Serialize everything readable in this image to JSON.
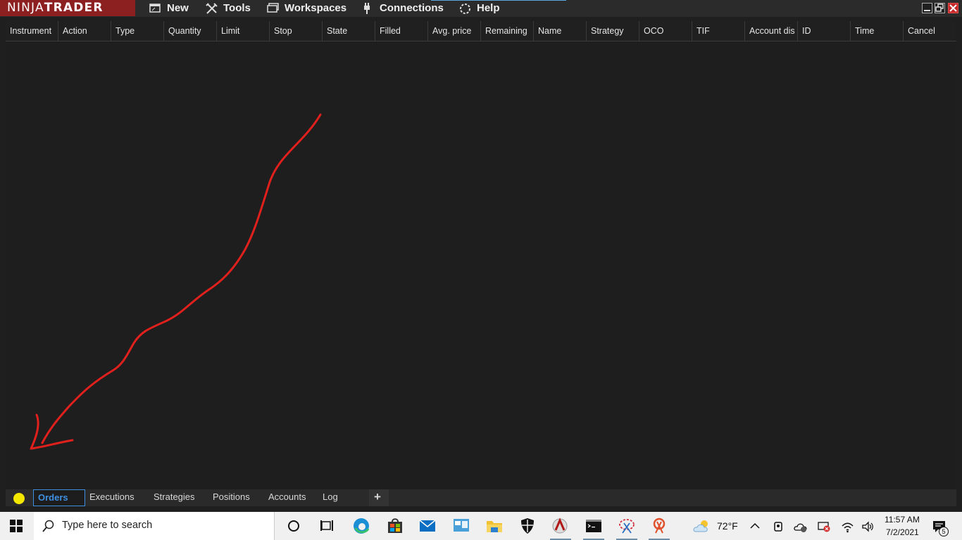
{
  "app": {
    "logo_left": "NINJA",
    "logo_right": "TRADER"
  },
  "menu": [
    {
      "label": "New",
      "icon": "new-window-icon"
    },
    {
      "label": "Tools",
      "icon": "tools-icon"
    },
    {
      "label": "Workspaces",
      "icon": "workspaces-icon"
    },
    {
      "label": "Connections",
      "icon": "plug-icon"
    },
    {
      "label": "Help",
      "icon": "help-icon"
    }
  ],
  "orders_grid": {
    "columns": [
      "Instrument",
      "Action",
      "Type",
      "Quantity",
      "Limit",
      "Stop",
      "State",
      "Filled",
      "Avg. price",
      "Remaining",
      "Name",
      "Strategy",
      "OCO",
      "TIF",
      "Account dis",
      "ID",
      "Time",
      "Cancel"
    ]
  },
  "tabs": [
    "Orders",
    "Executions",
    "Strategies",
    "Positions",
    "Accounts",
    "Log"
  ],
  "add_tab_label": "+",
  "active_tab": "Orders",
  "status_color": "#f4e800",
  "taskbar": {
    "search_placeholder": "Type here to search",
    "weather": "72°F",
    "time": "11:57 AM",
    "date": "7/2/2021",
    "notification_count": "5"
  },
  "colors": {
    "brand": "#8c1f1f",
    "accent": "#3f8fe0",
    "annotation": "#e0201c"
  }
}
